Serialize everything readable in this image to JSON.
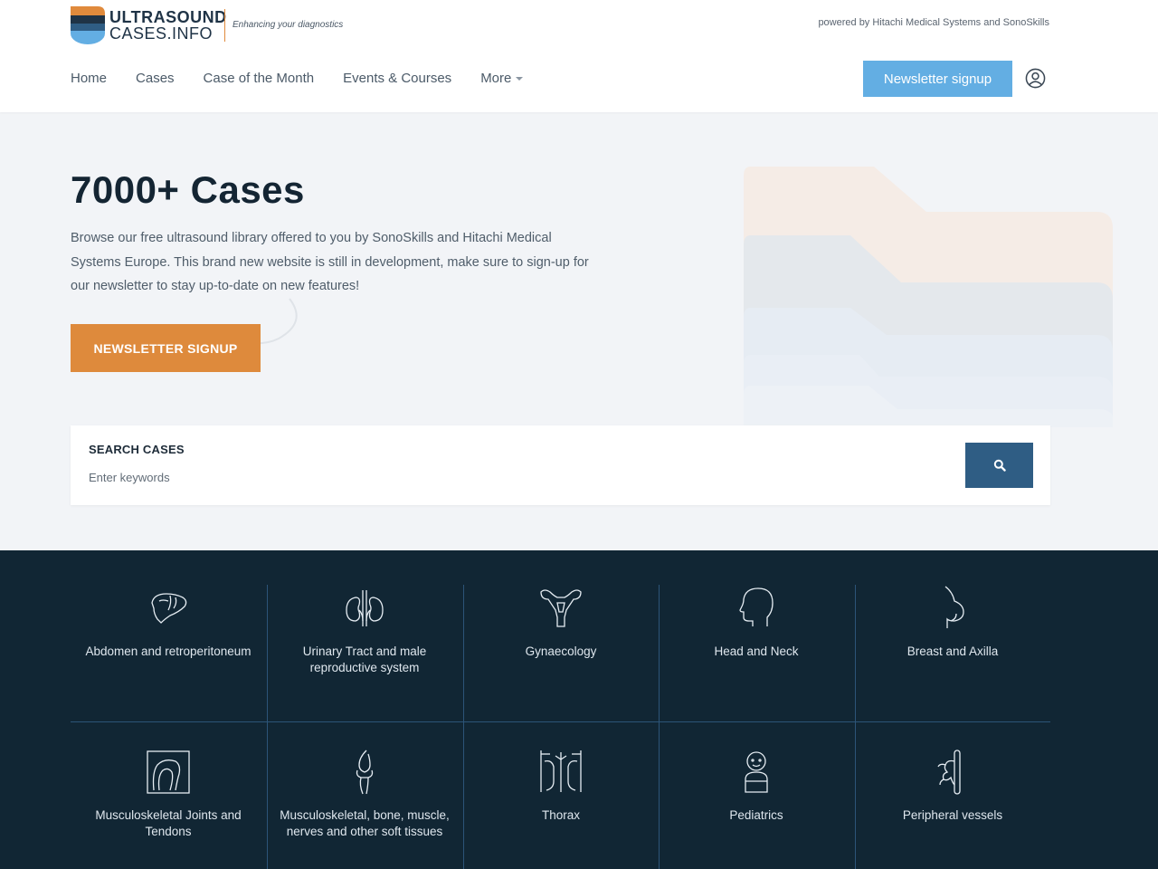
{
  "header": {
    "logo_line1": "ULTRASOUND",
    "logo_line2": "CASES.INFO",
    "tagline": "Enhancing your diagnostics",
    "powered_by": "powered by Hitachi Medical Systems and SonoSkills"
  },
  "nav": {
    "items": [
      {
        "label": "Home"
      },
      {
        "label": "Cases"
      },
      {
        "label": "Case of the Month"
      },
      {
        "label": "Events & Courses"
      },
      {
        "label": "More"
      }
    ],
    "newsletter_button": "Newsletter signup",
    "user_icon": "user-circle-icon"
  },
  "hero": {
    "title": "7000+ Cases",
    "text": "Browse our free ultrasound library offered to you by SonoSkills and Hitachi Medical Systems Europe. This brand new website is still in development, make sure to sign-up for our newsletter to stay up-to-date on new features!",
    "button": "NEWSLETTER SIGNUP"
  },
  "search": {
    "label": "SEARCH CASES",
    "placeholder": "Enter keywords",
    "button_icon": "search-icon"
  },
  "categories": [
    {
      "label": "Abdomen and retroperitoneum",
      "icon": "liver-icon"
    },
    {
      "label": "Urinary Tract and male reproductive system",
      "icon": "kidneys-icon"
    },
    {
      "label": "Gynaecology",
      "icon": "uterus-icon"
    },
    {
      "label": "Head and Neck",
      "icon": "head-icon"
    },
    {
      "label": "Breast and Axilla",
      "icon": "breast-icon"
    },
    {
      "label": "Musculoskeletal Joints and Tendons",
      "icon": "shoulder-joint-icon"
    },
    {
      "label": "Musculoskeletal, bone, muscle, nerves and other soft tissues",
      "icon": "knee-bone-icon"
    },
    {
      "label": "Thorax",
      "icon": "thorax-icon"
    },
    {
      "label": "Pediatrics",
      "icon": "child-icon"
    },
    {
      "label": "Peripheral vessels",
      "icon": "vessels-icon"
    }
  ],
  "colors": {
    "accent_orange": "#de8a3c",
    "accent_blue": "#63aee3",
    "search_button": "#2f5d84",
    "dark_band": "#112634"
  }
}
